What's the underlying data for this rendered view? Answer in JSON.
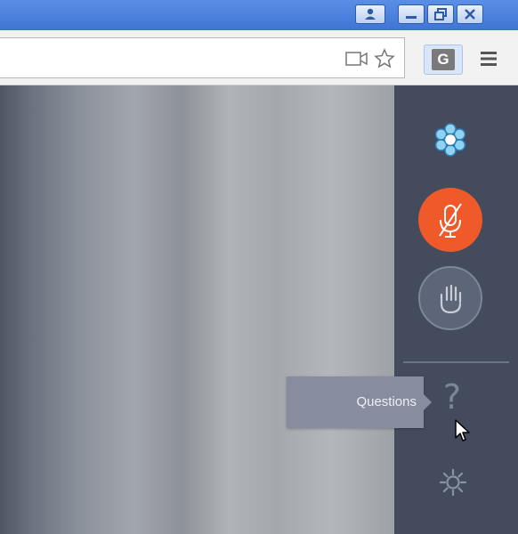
{
  "titlebar": {
    "buttons": [
      {
        "name": "profile",
        "icon": "user-icon"
      },
      {
        "name": "minimize",
        "icon": "minimize-icon"
      },
      {
        "name": "restore",
        "icon": "restore-icon"
      },
      {
        "name": "close",
        "icon": "close-icon"
      }
    ]
  },
  "toolbar": {
    "url": "",
    "icons": [
      "video-camera-icon",
      "star-icon"
    ],
    "extension_label": "G",
    "menu_icon": "hamburger-menu-icon"
  },
  "panel": {
    "buttons": [
      {
        "name": "app-logo",
        "icon": "snowflake-logo-icon"
      },
      {
        "name": "mute-microphone",
        "icon": "muted-microphone-icon",
        "state": "muted",
        "color": "#f05a2a"
      },
      {
        "name": "raise-hand",
        "icon": "hand-icon"
      },
      {
        "name": "questions",
        "icon": "question-icon",
        "glyph": "?"
      },
      {
        "name": "settings",
        "icon": "gear-icon"
      }
    ],
    "tooltip": "Questions"
  },
  "colors": {
    "titlebar": "#4a80e0",
    "panel": "#434b5d",
    "mic_active": "#f05a2a",
    "tooltip": "#868d9e"
  }
}
